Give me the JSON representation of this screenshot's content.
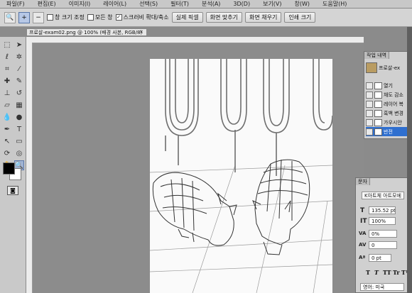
{
  "menubar": {
    "items": [
      "파일(F)",
      "편집(E)",
      "이미지(I)",
      "레이어(L)",
      "선택(S)",
      "필터(T)",
      "분석(A)",
      "3D(D)",
      "보기(V)",
      "창(W)",
      "도움말(H)"
    ]
  },
  "options": {
    "zoom_in_icon": "+",
    "zoom_out_icon": "−",
    "resize_windows_label": "창 크기 조정",
    "all_windows_label": "모든 창",
    "scrubby_zoom_label": "스크러비 확대/축소",
    "actual_pixels_label": "실제 픽셀",
    "fit_screen_label": "화면 맞추기",
    "fill_screen_label": "화면 채우기",
    "print_size_label": "인쇄 크기"
  },
  "document": {
    "tab_title": "프로살-exam02.png @ 100% (배경 사본, RGB/8)",
    "close_glyph": "×"
  },
  "history_panel": {
    "tab_label": "작업 내역",
    "snapshot_label": "프로살-ex",
    "items": [
      {
        "label": "열기",
        "selected": false
      },
      {
        "label": "채도 감소",
        "selected": false
      },
      {
        "label": "레이어 복",
        "selected": false
      },
      {
        "label": "흑백 변경",
        "selected": false
      },
      {
        "label": "가우시안",
        "selected": false
      },
      {
        "label": "반전",
        "selected": true
      }
    ]
  },
  "character_panel": {
    "tab_label": "문자",
    "font_family": "K아트체 아트모에",
    "font_size": "135.52 pt",
    "vertical_scale": "100%",
    "tracking": "0%",
    "kerning": "0",
    "baseline_shift": "0 pt",
    "language": "영어: 미국",
    "style_buttons": [
      "T",
      "T",
      "TT",
      "Tr",
      "T¹"
    ]
  },
  "colors": {
    "accent": "#2f6fcf",
    "foreground": "#000000",
    "background": "#ffffff"
  }
}
